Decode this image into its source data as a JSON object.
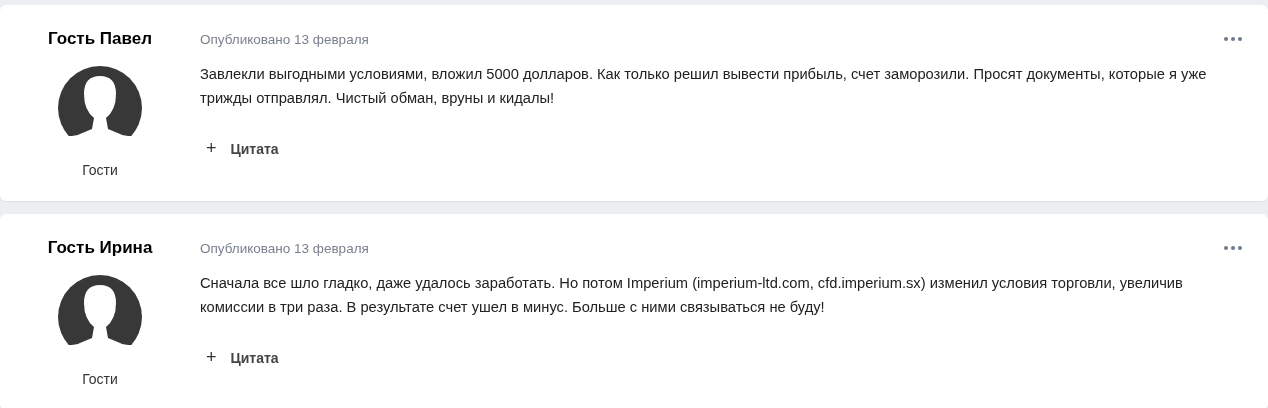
{
  "posts": [
    {
      "author": "Гость Павел",
      "group": "Гости",
      "date": "Опубликовано 13 февраля",
      "text": "Завлекли выгодными условиями, вложил 5000 долларов. Как только решил вывести прибыль, счет заморозили. Просят документы, которые я уже трижды отправлял. Чистый обман, вруны и кидалы!",
      "quote_icon": "+",
      "quote": "Цитата"
    },
    {
      "author": "Гость Ирина",
      "group": "Гости",
      "date": "Опубликовано 13 февраля",
      "text": "Сначала все шло гладко, даже удалось заработать. Но потом Imperium (imperium-ltd.com, cfd.imperium.sx) изменил условия торговли, увеличив комиссии в три раза. В результате счет ушел в минус. Больше с ними связываться не буду!",
      "quote_icon": "+",
      "quote": "Цитата"
    }
  ]
}
